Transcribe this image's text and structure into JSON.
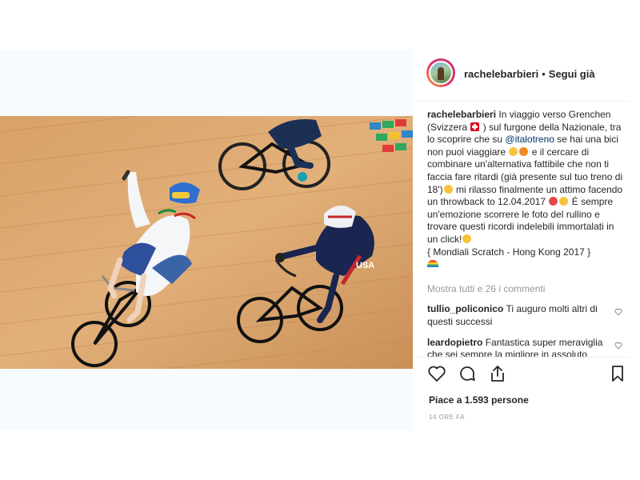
{
  "header": {
    "username": "rachelebarbieri",
    "separator": "•",
    "follow_label": "Segui già"
  },
  "caption": {
    "username": "rachelebarbieri",
    "text_1": "In viaggio verso Grenchen (Svizzera",
    "text_2": ") sul furgone della Nazionale, tra lo scoprire che su",
    "mention": "@italotreno",
    "text_3": "se hai una bici non puoi viaggiare",
    "text_4": "e il cercare di combinare un'alternativa fattibile che non ti faccia fare ritardi (già presente sul tuo treno di 18')",
    "text_5": "mi rilasso finalmente un attimo facendo un throwback to 12.04.2017",
    "text_6": "É sempre un'emozione scorrere le foto del rullino e trovare questi ricordi indelebili immortalati in un click!",
    "text_7": "{ Mondiali Scratch - Hong Kong 2017 }"
  },
  "view_all_comments": "Mostra tutti e 26 i commenti",
  "comments": [
    {
      "username": "tullio_policonico",
      "text": "Ti auguro molti altri di questi successi"
    },
    {
      "username": "leardopietro",
      "text": "Fantastica super meraviglia che sei sempre la migliore in assoluto"
    }
  ],
  "likes_text": "Piace a 1.593 persone",
  "timestamp": "14 ORE FA",
  "icons": {
    "like": "heart-outline-icon",
    "comment": "speech-bubble-icon",
    "share": "share-upload-icon",
    "save": "bookmark-icon",
    "comment_like": "small-heart-icon"
  },
  "colors": {
    "mention": "#003569",
    "muted": "#999999",
    "text": "#262626",
    "border": "#efefef"
  }
}
